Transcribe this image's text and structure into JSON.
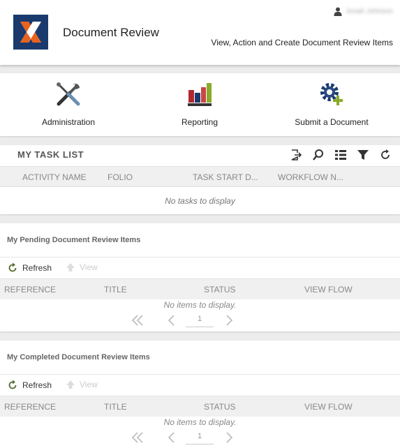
{
  "header": {
    "app_title": "Document Review",
    "subtitle": "View, Action and Create Document Review Items",
    "user_name": "Jonah Johnson"
  },
  "tiles": [
    {
      "label": "Administration",
      "icon": "tools-icon"
    },
    {
      "label": "Reporting",
      "icon": "bar-chart-icon"
    },
    {
      "label": "Submit a Document",
      "icon": "gear-plus-icon"
    }
  ],
  "task_list": {
    "title": "MY TASK LIST",
    "columns": [
      "ACTIVITY NAME",
      "FOLIO",
      "TASK START D...",
      "WORKFLOW N..."
    ],
    "empty_text": "No tasks to display",
    "tools": [
      "export-icon",
      "search-icon",
      "list-icon",
      "filter-icon",
      "refresh-icon"
    ]
  },
  "pending": {
    "title": "My Pending Document Review Items",
    "refresh_label": "Refresh",
    "view_label": "View",
    "columns": [
      "REFERENCE",
      "TITLE",
      "STATUS",
      "VIEW FLOW"
    ],
    "empty_text": "No items to display.",
    "page": "1"
  },
  "completed": {
    "title": "My Completed Document Review Items",
    "refresh_label": "Refresh",
    "view_label": "View",
    "columns": [
      "REFERENCE",
      "TITLE",
      "STATUS",
      "VIEW FLOW"
    ],
    "empty_text": "No items to display.",
    "page": "1"
  },
  "colors": {
    "logo_blue": "#1a3a6e",
    "logo_orange": "#e9631e",
    "accent_green": "#8aaa2a",
    "chart_red": "#b0282f"
  }
}
